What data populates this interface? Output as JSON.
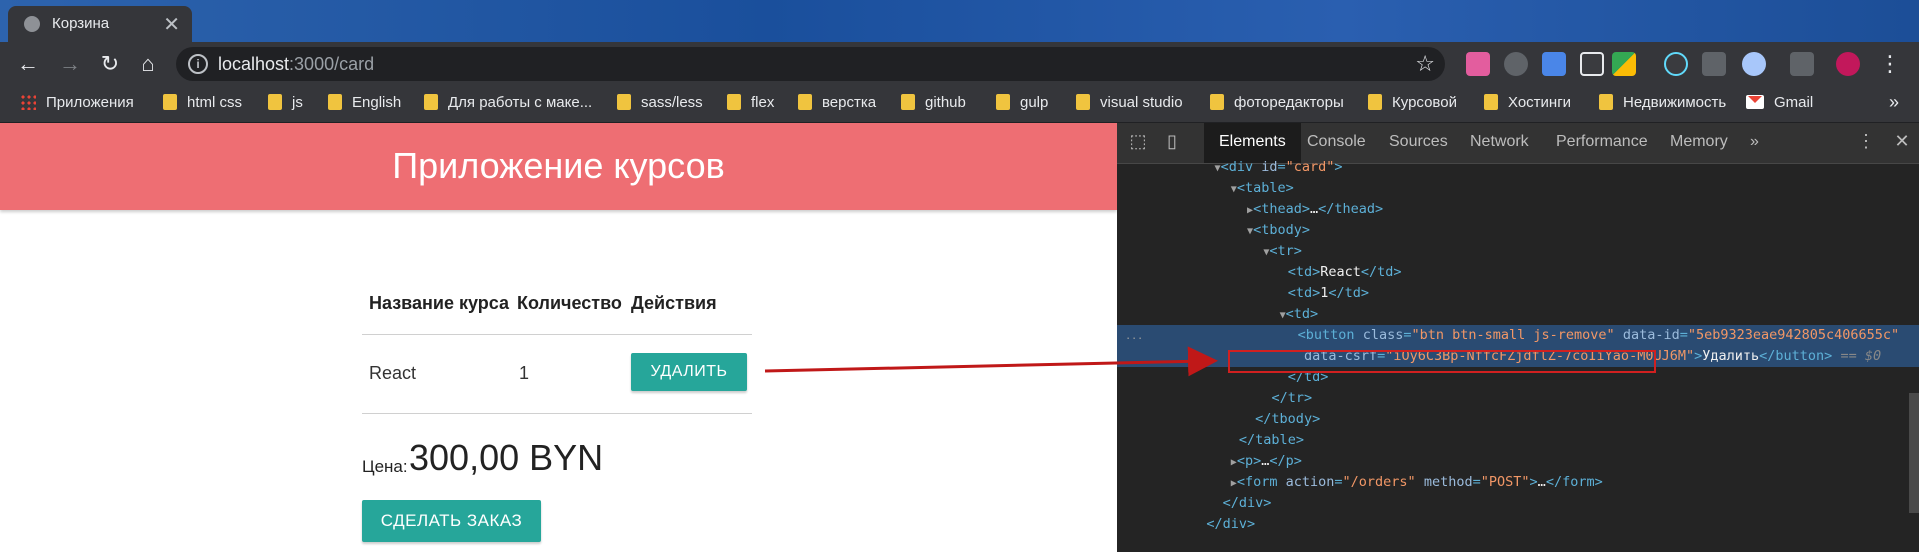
{
  "tab": {
    "title": "Корзина",
    "close": "✕"
  },
  "toolbar": {
    "back": "←",
    "forward": "→",
    "reload": "↻",
    "home": "⌂",
    "url_host": "localhost",
    "url_path": ":3000/card",
    "star": "☆"
  },
  "bookmarks": {
    "apps": "Приложения",
    "items": [
      "html css",
      "js",
      "English",
      "Для работы с маке...",
      "sass/less",
      "flex",
      "верстка",
      "github",
      "gulp",
      "visual studio",
      "фоторедакторы",
      "Курсовой",
      "Хостинги",
      "Недвижимость"
    ],
    "gmail": "Gmail",
    "more": "»"
  },
  "page": {
    "brand": "Приложение курсов",
    "table": {
      "headers": [
        "Название курса",
        "Количество",
        "Действия"
      ],
      "rows": [
        {
          "title": "React",
          "count": "1",
          "action": "УДАЛИТЬ"
        }
      ]
    },
    "price_label": "Цена:",
    "price_value": "300,00 BYN",
    "order_button": "СДЕЛАТЬ ЗАКАЗ"
  },
  "devtools": {
    "tabs": [
      "Elements",
      "Console",
      "Sources",
      "Network",
      "Performance",
      "Memory"
    ],
    "more_tabs": "»",
    "menu": "⋮",
    "close": "✕",
    "dots": "..."
  },
  "colors": {
    "appbar": "#ee6e73",
    "button": "#26a69a",
    "arrow": "#c01818",
    "devtools_bg": "#242424"
  }
}
